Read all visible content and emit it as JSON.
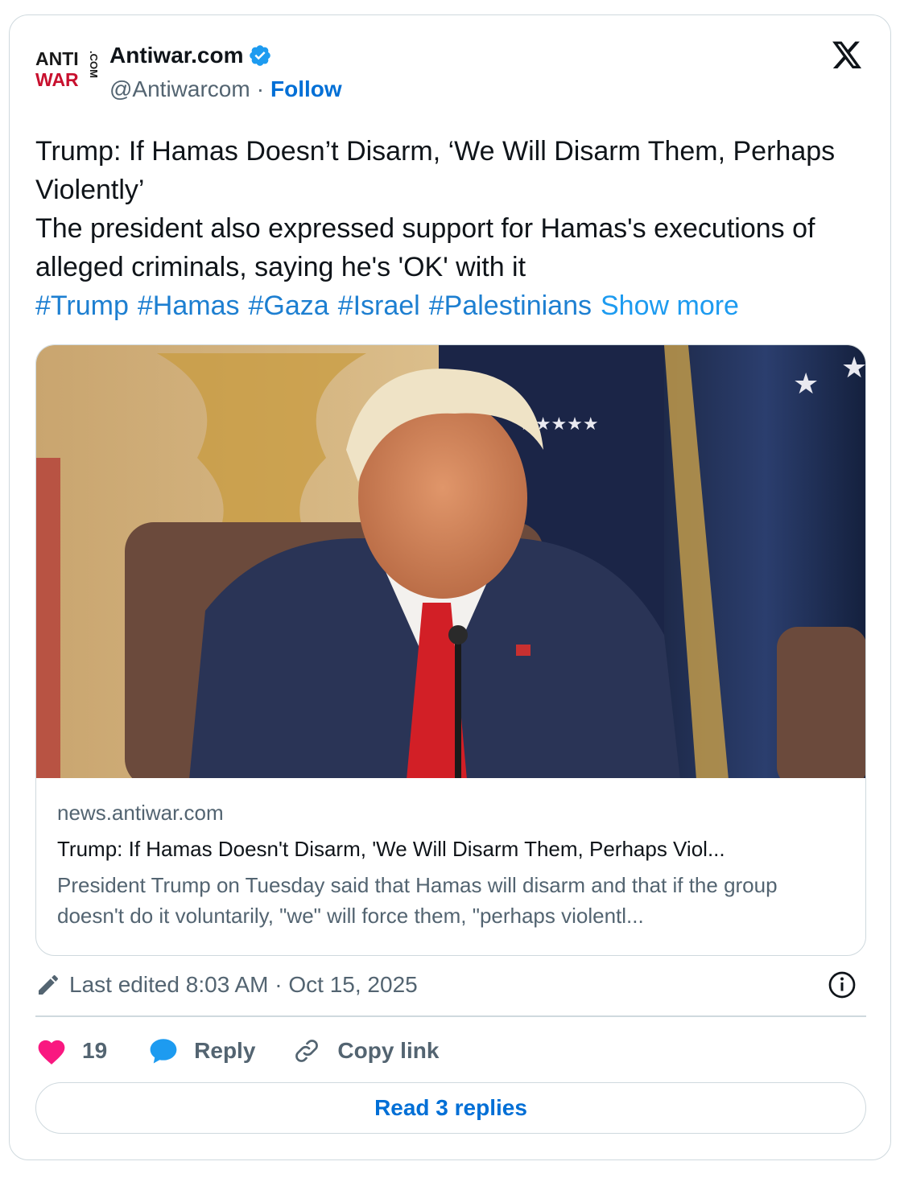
{
  "author": {
    "name": "Antiwar.com",
    "handle": "@Antiwarcom",
    "separator": "·",
    "follow_label": "Follow",
    "logo_text": {
      "anti": "ANTI",
      "war": "WAR",
      "com": ".COM"
    },
    "verified_icon": "verified-badge-icon"
  },
  "post": {
    "title_line": "Trump: If Hamas Doesn’t Disarm, ‘We Will Disarm Them, Perhaps Violently’",
    "body_line": "The president also expressed support for Hamas's executions of alleged criminals, saying he's 'OK' with it",
    "hashtags": [
      "#Trump",
      "#Hamas",
      "#Gaza",
      "#Israel",
      "#Palestinians"
    ],
    "show_more_label": "Show more"
  },
  "link_card": {
    "domain": "news.antiwar.com",
    "title": "Trump: If Hamas Doesn't Disarm, 'We Will Disarm Them, Perhaps Viol...",
    "description": "President Trump on Tuesday said that Hamas will disarm and that if the group doesn't do it voluntarily, \"we\" will force them, \"perhaps violentl..."
  },
  "meta": {
    "edited_text": "Last edited 8:03 AM · Oct 15, 2025"
  },
  "actions": {
    "like_count": "19",
    "reply_label": "Reply",
    "copy_label": "Copy link"
  },
  "read_replies_label": "Read 3 replies",
  "colors": {
    "accent_blue": "#006fd6",
    "hashtag_blue": "#1d7fd1",
    "like_pink": "#f91880",
    "reply_blue": "#1d9bf0",
    "logo_red": "#c8102e",
    "border": "#cfd9de"
  }
}
